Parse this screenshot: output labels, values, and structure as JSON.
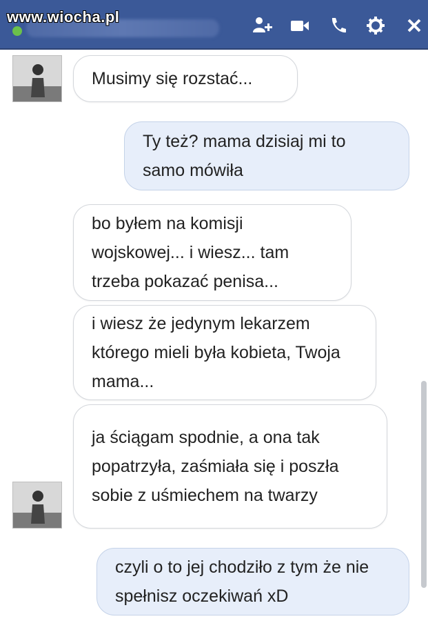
{
  "watermark": "www.wiocha.pl",
  "header": {
    "icons": [
      "add-friend-icon",
      "video-call-icon",
      "phone-icon",
      "gear-icon",
      "close-icon"
    ],
    "background_color": "#3b5998",
    "contact_status": "online"
  },
  "messages": [
    {
      "side": "incoming",
      "text": "Musimy się rozstać..."
    },
    {
      "side": "outgoing",
      "text": "Ty też? mama dzisiaj mi to samo mówiła"
    },
    {
      "side": "incoming",
      "text": "bo byłem na komisji wojskowej... i wiesz... tam trzeba pokazać penisa..."
    },
    {
      "side": "incoming",
      "text": "i wiesz że jedynym lekarzem którego mieli była kobieta, Twoja mama..."
    },
    {
      "side": "incoming",
      "text": "ja ściągam spodnie, a ona tak popatrzyła, zaśmiała się i poszła sobie z uśmiechem na twarzy"
    },
    {
      "side": "outgoing",
      "text": "czyli o to jej chodziło z tym że nie spełnisz oczekiwań xD"
    }
  ],
  "colors": {
    "incoming_bubble": "#ffffff",
    "outgoing_bubble": "#e7eefa",
    "chat_background": "#ffffff",
    "online": "#6bc04b"
  }
}
